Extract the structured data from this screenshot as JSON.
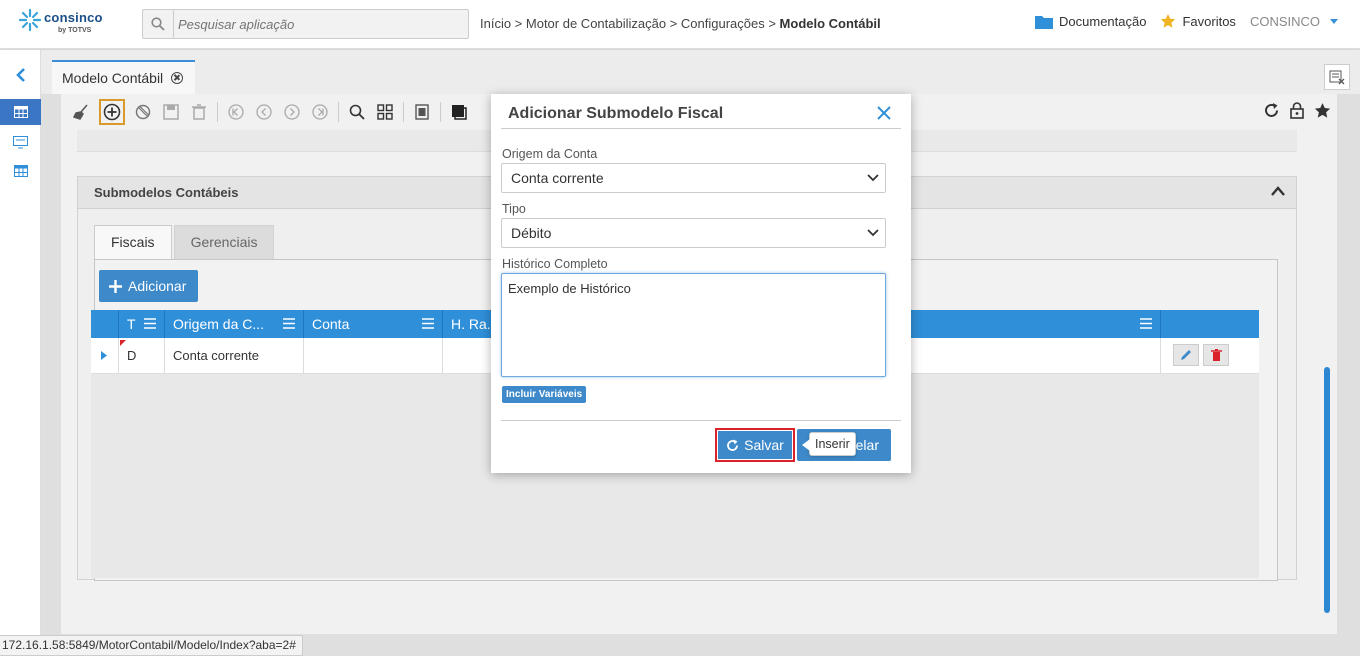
{
  "header": {
    "logo_text": "consinco",
    "logo_sub": "by TOTVS",
    "search_placeholder": "Pesquisar aplicação",
    "breadcrumb_path": "Início > Motor de Contabilização > Configurações > ",
    "breadcrumb_current": "Modelo Contábil",
    "docs_label": "Documentação",
    "favorites_label": "Favoritos",
    "user_label": "CONSINCO"
  },
  "tabbar": {
    "page_tab": "Modelo Contábil"
  },
  "panel": {
    "title": "Submodelos Contábeis",
    "tabs": [
      "Fiscais",
      "Gerenciais"
    ],
    "add_label": "Adicionar",
    "columns": [
      "T",
      "Origem da C...",
      "Conta",
      "H. Ra..."
    ],
    "row": {
      "tipo": "D",
      "origem": "Conta corrente",
      "conta": "",
      "hra": ""
    }
  },
  "modal": {
    "title": "Adicionar Submodelo Fiscal",
    "origem_label": "Origem da Conta",
    "origem_value": "Conta corrente",
    "tipo_label": "Tipo",
    "tipo_value": "Débito",
    "historico_label": "Histórico Completo",
    "historico_value": "Exemplo de Histórico",
    "incluir_label": "Incluir Variáveis",
    "salvar_label": "Salvar",
    "cancelar_label": "elar",
    "tooltip": "Inserir"
  },
  "statusbar": {
    "url": "172.16.1.58:5849/MotorContabil/Modelo/Index?aba=2#"
  },
  "colors": {
    "accent": "#3d89c9",
    "grid_header": "#2f8fd8",
    "highlight_border": "#d9222a",
    "star": "#f0b323"
  }
}
